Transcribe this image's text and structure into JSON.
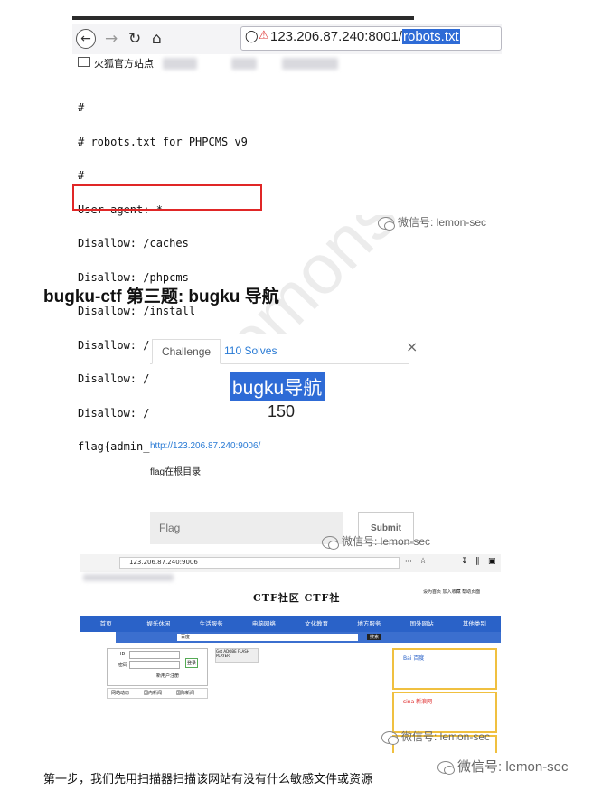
{
  "shot1": {
    "url_host": "123.206.87.240:8001/",
    "url_path": "robots.txt",
    "bookmark_label": "火狐官方站点",
    "robots_lines": [
      "#",
      "# robots.txt for PHPCMS v9",
      "#",
      "User-agent: *",
      "Disallow: /caches",
      "Disallow: /phpcms",
      "Disallow: /install",
      "Disallow: /phpsso_server",
      "Disallow: /api",
      "Disallow: /admin.php",
      "flag{admin_a23-ae2132_key}"
    ]
  },
  "watermark": "微信号: lemon-sec",
  "watermark_big": "lemonsec",
  "heading": "bugku-ctf  第三题: bugku 导航",
  "modal": {
    "tab_challenge": "Challenge",
    "tab_solves": "110 Solves",
    "close": "×",
    "challenge_name": "bugku导航",
    "points": "150",
    "link": "http://123.206.87.240:9006/",
    "description": "flag在根目录",
    "input_placeholder": "Flag",
    "submit_label": "Submit"
  },
  "shot3": {
    "url": "123.206.87.240:9006",
    "site_title": "CTF社区  CTF社",
    "top_links": "设为首页  加入收藏  帮助页面",
    "nav": [
      "首页",
      "娱乐休闲",
      "生活服务",
      "电脑网络",
      "文化教育",
      "地方服务",
      "国外网站",
      "其他类别"
    ],
    "login_id_label": "ID",
    "login_pw_label": "密码",
    "login_button": "登录",
    "register_label": "新用户注册",
    "search_button": "搜索",
    "search_engine": "百度",
    "tabs": [
      "网站动态",
      "国内新闻",
      "国际新闻"
    ],
    "card_1": "Bai 百度",
    "card_2": "sina 新浪网",
    "ad_text": "Get ADOBE FLASH PLAYER"
  },
  "caption": "第一步，我们先用扫描器扫描该网站有没有什么敏感文件或资源"
}
